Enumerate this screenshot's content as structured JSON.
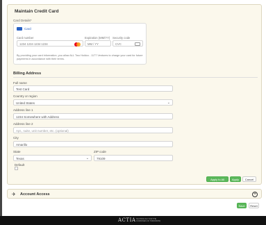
{
  "card_section": {
    "title": "Maintain Credit Card",
    "details_label": "Card Details*",
    "card_type": "Card",
    "card_number_label": "Card number",
    "card_number_placeholder": "1234 1234 1234 1234",
    "expiration_label": "Expiration (MM/YY)",
    "expiration_placeholder": "MM / YY",
    "security_label": "Security code",
    "security_placeholder": "CVC",
    "note": "By providing your card information, you allow ALL Two Holdco - 1177 Ventures to charge your card for future payments in accordance with their terms."
  },
  "billing": {
    "title": "Billing Address",
    "full_name_label": "Full name",
    "full_name_value": "Test Card",
    "country_label": "Country or region",
    "country_value": "United States",
    "address1_label": "Address line 1",
    "address1_value": "1234 Somewhere with Address",
    "address2_label": "Address line 2",
    "address2_placeholder": "Apt., suite, unit number, etc. (optional)",
    "city_label": "City",
    "city_value": "Amarillo",
    "state_label": "State",
    "state_value": "Texas",
    "zip_label": "ZIP code",
    "zip_value": "79109",
    "default_label": "Default"
  },
  "actions": {
    "apply_all": "Apply to All",
    "apply": "Apply",
    "cancel": "Cancel"
  },
  "accordion": {
    "title": "Account Access"
  },
  "footer_actions": {
    "save": "Save",
    "reset": "Reset"
  },
  "footer": {
    "brand": "ACTIA",
    "sub_line1": "TECHNOLOGY FOR THE",
    "sub_line2": "COMPANIES OF TOMORROW"
  },
  "colors": {
    "accent_green": "#5cb85c",
    "panel_bg": "#fbf8ec",
    "footer_bg": "#111111"
  }
}
